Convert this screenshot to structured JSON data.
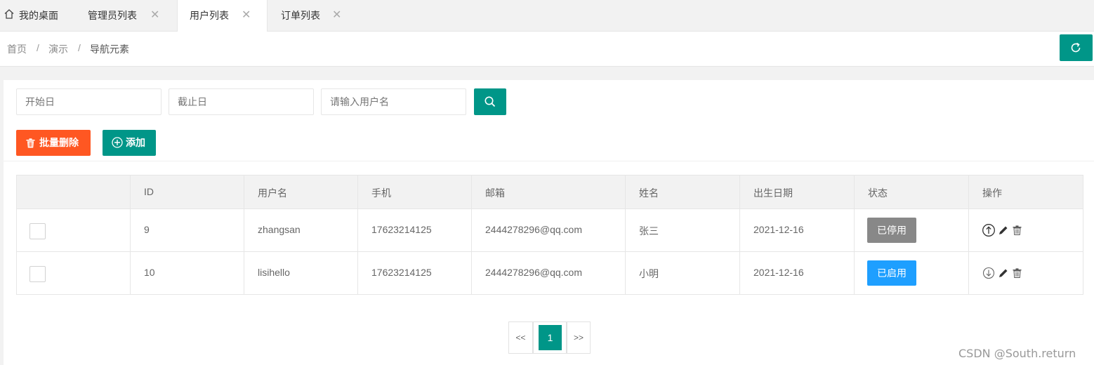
{
  "tabs": [
    {
      "label": "我的桌面",
      "closable": false,
      "active": false,
      "icon": "home-icon"
    },
    {
      "label": "管理员列表",
      "closable": true,
      "active": false
    },
    {
      "label": "用户列表",
      "closable": true,
      "active": true
    },
    {
      "label": "订单列表",
      "closable": true,
      "active": false
    }
  ],
  "tab_close_glyph": "✕",
  "breadcrumb": {
    "items": [
      "首页",
      "演示",
      "导航元素"
    ],
    "separator": "/"
  },
  "refresh_icon": "refresh-icon",
  "filters": {
    "start_placeholder": "开始日",
    "end_placeholder": "截止日",
    "username_placeholder": "请输入用户名"
  },
  "toolbar": {
    "batch_delete_label": "批量删除",
    "add_label": "添加"
  },
  "table": {
    "headers": [
      "",
      "ID",
      "用户名",
      "手机",
      "邮箱",
      "姓名",
      "出生日期",
      "状态",
      "操作"
    ],
    "rows": [
      {
        "id": "9",
        "username": "zhangsan",
        "phone": "17623214125",
        "email": "2444278296@qq.com",
        "name": "张三",
        "birth": "2021-12-16",
        "status": "已停用",
        "status_kind": "disabled"
      },
      {
        "id": "10",
        "username": "lisihello",
        "phone": "17623214125",
        "email": "2444278296@qq.com",
        "name": "小明",
        "birth": "2021-12-16",
        "status": "已启用",
        "status_kind": "enabled"
      }
    ]
  },
  "pagination": {
    "prev": "<<",
    "current": "1",
    "next": ">>"
  },
  "colors": {
    "primary": "#009688",
    "danger": "#ff5722",
    "enabled": "#1e9fff",
    "disabled": "#888888"
  },
  "watermark": "CSDN @South.return"
}
